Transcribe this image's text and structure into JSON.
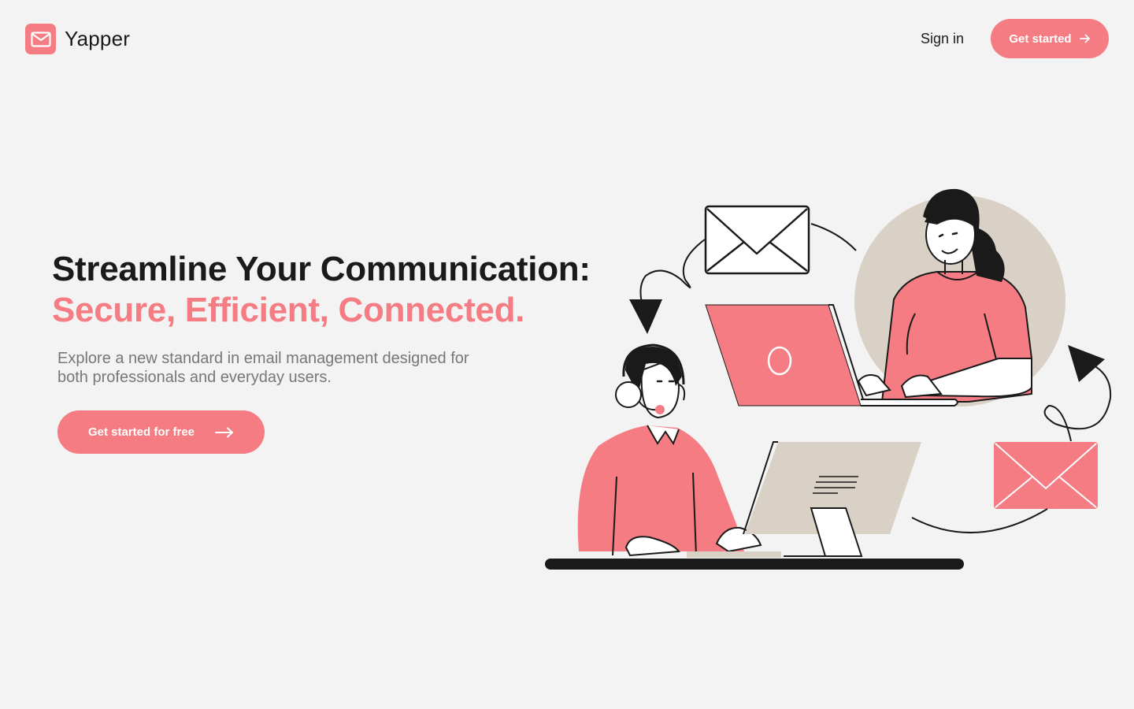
{
  "header": {
    "brand": "Yapper",
    "sign_in": "Sign in",
    "cta_label": "Get started"
  },
  "hero": {
    "title_line1": "Streamline Your Communication:",
    "title_line2": "Secure, Efficient, Connected.",
    "subtitle": "Explore a new standard in email management designed for both professionals and everyday users.",
    "cta_label": "Get started for free"
  },
  "colors": {
    "accent": "#f47c82",
    "background": "#f3f3f3",
    "text": "#1a1a1a",
    "muted": "#777777",
    "beige": "#d9d1c6"
  },
  "icons": {
    "logo": "mail-icon",
    "arrow": "arrow-right-icon"
  }
}
